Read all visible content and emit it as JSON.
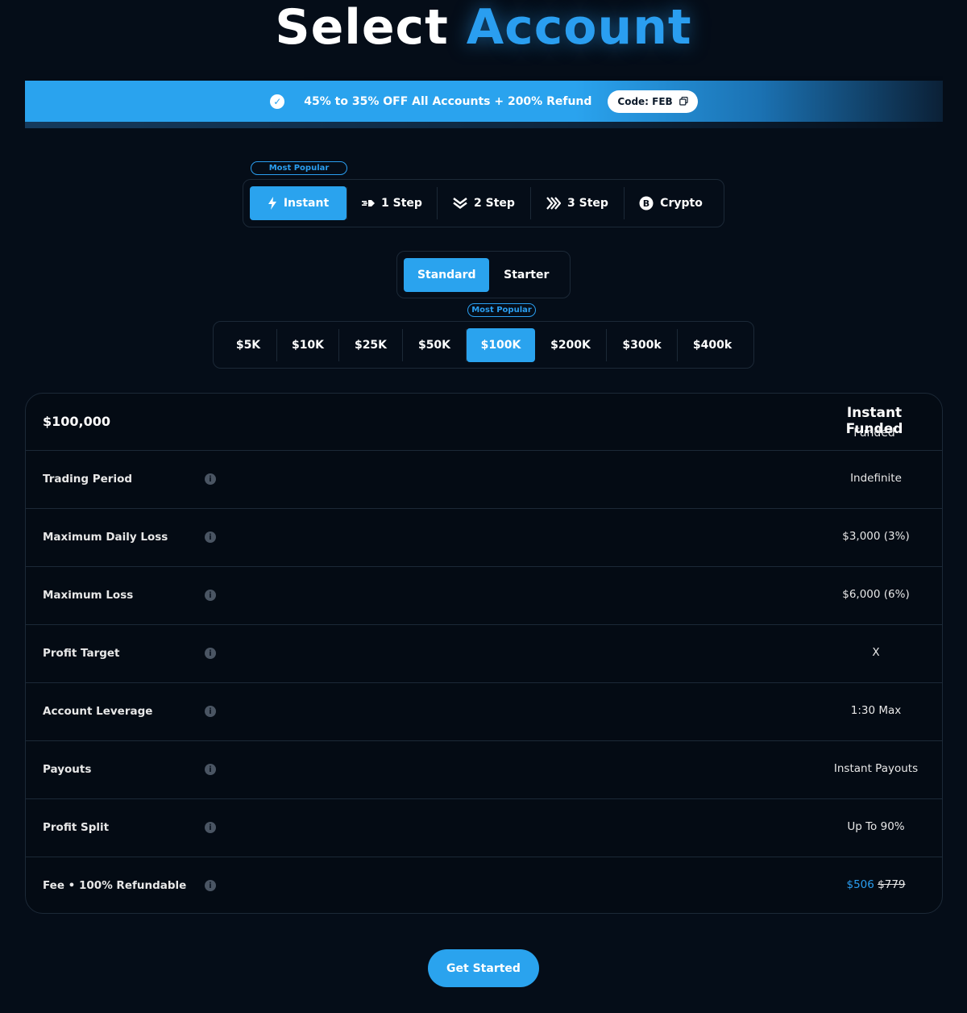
{
  "header": {
    "title_white": "Select",
    "title_blue": "Account"
  },
  "promo": {
    "text": "45% to 35% OFF All Accounts + 200% Refund",
    "code_label": "Code: FEB",
    "verify_icon": "verified-badge-icon",
    "copy_icon": "copy-icon"
  },
  "program_tabs": {
    "badge": "Most Popular",
    "items": [
      {
        "label": "Instant",
        "icon": "lightning-icon",
        "active": true
      },
      {
        "label": "1 Step",
        "icon": "fast-arrow-icon",
        "active": false
      },
      {
        "label": "2 Step",
        "icon": "double-chevron-down-icon",
        "active": false
      },
      {
        "label": "3 Step",
        "icon": "triple-chevron-right-icon",
        "active": false
      },
      {
        "label": "Crypto",
        "icon": "bitcoin-icon",
        "active": false
      }
    ]
  },
  "tier_tabs": {
    "items": [
      {
        "label": "Standard",
        "active": true
      },
      {
        "label": "Starter",
        "active": false
      }
    ]
  },
  "size_tabs": {
    "badge": "Most Popular",
    "items": [
      {
        "label": "$5K",
        "active": false
      },
      {
        "label": "$10K",
        "active": false
      },
      {
        "label": "$25K",
        "active": false
      },
      {
        "label": "$50K",
        "active": false
      },
      {
        "label": "$100K",
        "active": true
      },
      {
        "label": "$200K",
        "active": false
      },
      {
        "label": "$300k",
        "active": false
      },
      {
        "label": "$400k",
        "active": false
      }
    ]
  },
  "details": {
    "amount": "$100,000",
    "plan_title": "Instant Funded",
    "plan_subtitle": "Funded",
    "rows": [
      {
        "label": "Trading Period",
        "value": "Indefinite"
      },
      {
        "label": "Maximum Daily Loss",
        "value": "$3,000 (3%)"
      },
      {
        "label": "Maximum Loss",
        "value": "$6,000 (6%)"
      },
      {
        "label": "Profit Target",
        "value": "X"
      },
      {
        "label": "Account Leverage",
        "value": "1:30 Max"
      },
      {
        "label": "Payouts",
        "value": "Instant Payouts"
      },
      {
        "label": "Profit Split",
        "value": "Up To 90%"
      },
      {
        "label": "Fee • 100% Refundable",
        "price_now": "$506",
        "price_old": "$779"
      }
    ]
  },
  "cta": {
    "label": "Get Started"
  },
  "colors": {
    "background": "#050d18",
    "accent": "#2aa3ee",
    "border": "#1c2937"
  }
}
